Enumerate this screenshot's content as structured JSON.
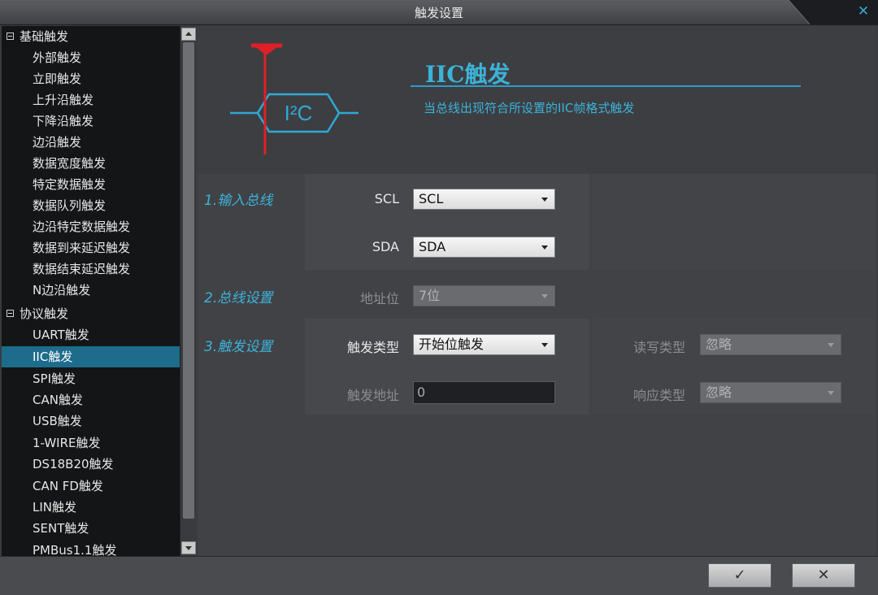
{
  "window": {
    "title": "触发设置",
    "close_glyph": "✕"
  },
  "tree": {
    "groups": [
      {
        "label": "基础触发",
        "items": [
          "外部触发",
          "立即触发",
          "上升沿触发",
          "下降沿触发",
          "边沿触发",
          "数据宽度触发",
          "特定数据触发",
          "数据队列触发",
          "边沿特定数据触发",
          "数据到来延迟触发",
          "数据结束延迟触发",
          "N边沿触发"
        ]
      },
      {
        "label": "协议触发",
        "items": [
          "UART触发",
          "IIC触发",
          "SPI触发",
          "CAN触发",
          "USB触发",
          "1-WIRE触发",
          "DS18B20触发",
          "CAN FD触发",
          "LIN触发",
          "SENT触发",
          "PMBus1.1触发"
        ]
      }
    ],
    "selected": "IIC触发"
  },
  "header": {
    "icon_text": "I²C",
    "title": "IIC触发",
    "description": "当总线出现符合所设置的IIC帧格式触发"
  },
  "sections": {
    "input_bus": {
      "label": "1.输入总线",
      "scl": {
        "label": "SCL",
        "value": "SCL"
      },
      "sda": {
        "label": "SDA",
        "value": "SDA"
      }
    },
    "bus_settings": {
      "label": "2.总线设置",
      "address_bits": {
        "label": "地址位",
        "value": "7位"
      }
    },
    "trigger_settings": {
      "label": "3.触发设置",
      "trigger_type": {
        "label": "触发类型",
        "value": "开始位触发"
      },
      "trigger_address": {
        "label": "触发地址",
        "value": "0"
      },
      "rw_type": {
        "label": "读写类型",
        "value": "忽略"
      },
      "ack_type": {
        "label": "响应类型",
        "value": "忽略"
      }
    }
  },
  "buttons": {
    "ok": "✓",
    "cancel": "✕"
  },
  "colors": {
    "accent": "#3cb2d8",
    "selection": "#1d6c8c",
    "marker": "#e01f26"
  }
}
